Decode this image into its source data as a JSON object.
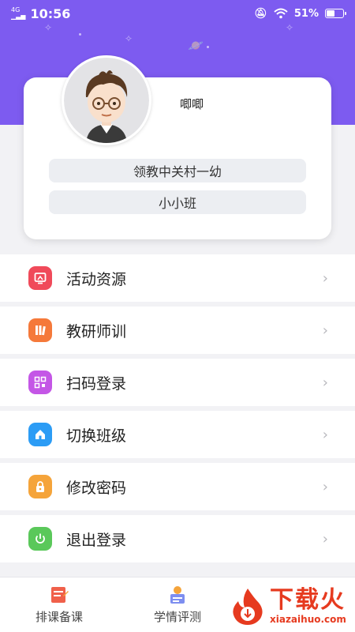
{
  "status_bar": {
    "network": "4G",
    "time": "10:56",
    "battery": "51%",
    "battery_level": 0.51,
    "icons": [
      "silent-icon",
      "wifi-icon",
      "battery-icon"
    ]
  },
  "profile": {
    "username": "唧唧",
    "school": "领教中关村一幼",
    "class_name": "小小班"
  },
  "menu": [
    {
      "label": "活动资源",
      "icon": "monitor-icon",
      "color": "#f04a5a"
    },
    {
      "label": "教研师训",
      "icon": "books-icon",
      "color": "#f5793a"
    },
    {
      "label": "扫码登录",
      "icon": "qrcode-icon",
      "color": "#c456e6"
    },
    {
      "label": "切换班级",
      "icon": "home-icon",
      "color": "#2c9cf5"
    },
    {
      "label": "修改密码",
      "icon": "lock-icon",
      "color": "#f5a43a"
    },
    {
      "label": "退出登录",
      "icon": "power-icon",
      "color": "#5ac85a"
    }
  ],
  "tabs": [
    {
      "label": "排课备课",
      "icon": "schedule-icon"
    },
    {
      "label": "学情评测",
      "icon": "assessment-icon"
    }
  ],
  "watermark": {
    "title": "下载火",
    "subtitle": "xiazaihuo.com"
  },
  "colors": {
    "header": "#7d5bf0",
    "background": "#f2f2f5",
    "watermark": "#e63a1f"
  }
}
